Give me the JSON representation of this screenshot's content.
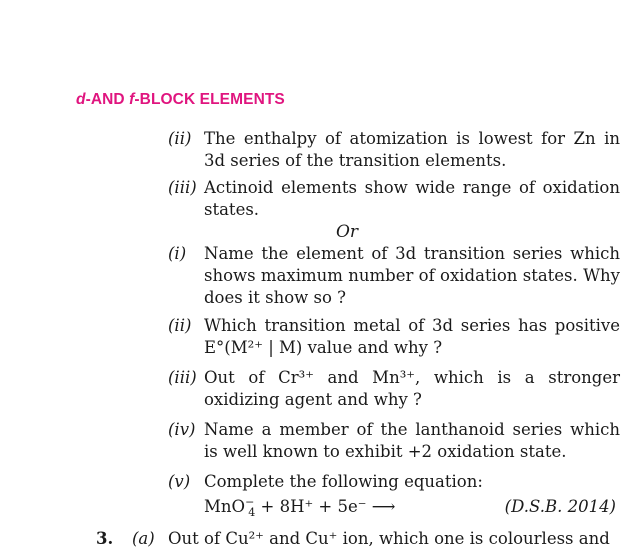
{
  "header": {
    "d": "d",
    "mid": "-AND ",
    "f": "f",
    "rest": "-BLOCK ELEMENTS"
  },
  "items_top": [
    {
      "num": "(ii)",
      "text": "The enthalpy of atomization is lowest for Zn in 3d series of the transition elements."
    },
    {
      "num": "(iii)",
      "text": "Actinoid elements show wide range of oxidation states."
    }
  ],
  "or_label": "Or",
  "items_or": [
    {
      "num": "(i)",
      "text": "Name the element of 3d transition series which shows maximum number of oxidation states. Why does it show so ?"
    },
    {
      "num": "(ii)",
      "text": "Which transition metal of 3d series has positive E°(M²⁺ | M) value and why ?"
    },
    {
      "num": "(iii)",
      "text": "Out of Cr³⁺ and Mn³⁺, which is a stronger oxidizing agent and why ?"
    },
    {
      "num": "(iv)",
      "text": "Name a member of the lanthanoid series which is well known to exhibit +2 oxidation state."
    },
    {
      "num": "(v)",
      "text": "Complete the following equation:"
    }
  ],
  "equation": {
    "base": "MnO",
    "sub": "4",
    "sup": "−",
    "rest": " + 8H⁺ + 5e⁻ ⟶"
  },
  "source": "(D.S.B. 2014)",
  "q3": {
    "num": "3.",
    "part": "(a)",
    "text": "Out of Cu²⁺ and Cu⁺ ion, which one is colourless and"
  }
}
